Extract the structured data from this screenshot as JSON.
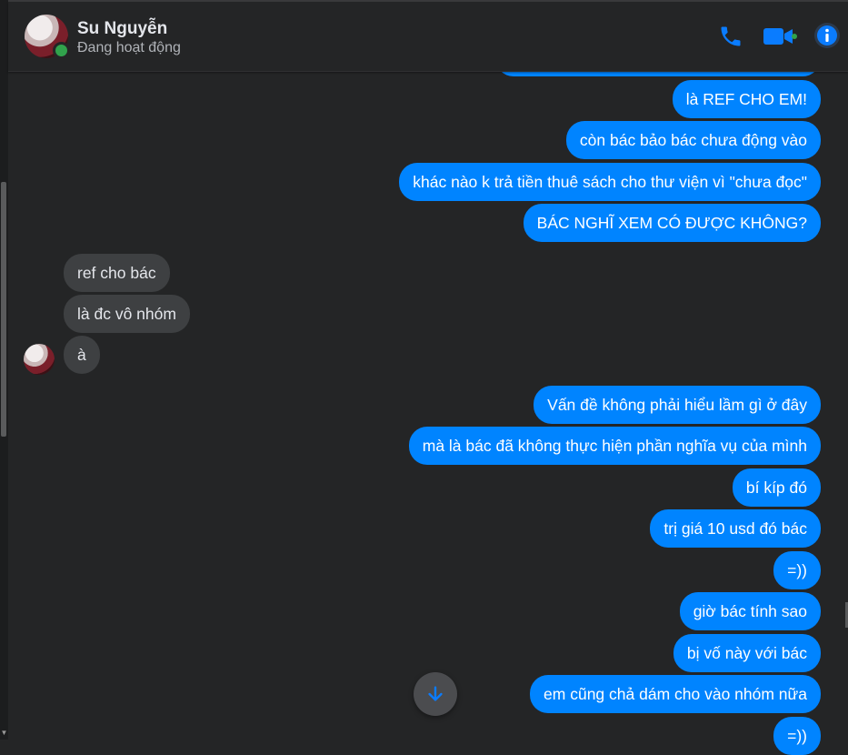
{
  "header": {
    "contact_name": "Su Nguyễn",
    "status": "Đang hoạt động"
  },
  "icons": {
    "phone": "phone-icon",
    "video": "video-camera-icon",
    "info": "info-icon",
    "scroll_down": "arrow-down-icon",
    "accent_color": "#0084ff"
  },
  "messages": [
    {
      "side": "out",
      "text": "là REF CHO EM!"
    },
    {
      "side": "out",
      "text": "còn bác bảo bác chưa động vào"
    },
    {
      "side": "out",
      "text": "khác nào k trả tiền thuê sách cho thư viện vì \"chưa đọc\""
    },
    {
      "side": "out",
      "text": "BÁC NGHĨ XEM CÓ ĐƯỢC KHÔNG?"
    },
    {
      "side": "in",
      "text": "ref cho bác"
    },
    {
      "side": "in",
      "text": "là đc vô nhóm"
    },
    {
      "side": "in",
      "text": "à"
    },
    {
      "side": "out",
      "text": "Vấn đề không phải hiểu lầm gì ở đây"
    },
    {
      "side": "out",
      "text": "mà là bác đã không thực hiện phần nghĩa vụ của mình"
    },
    {
      "side": "out",
      "text": "bí kíp đó"
    },
    {
      "side": "out",
      "text": "trị giá 10 usd đó bác"
    },
    {
      "side": "out",
      "text": "=))"
    },
    {
      "side": "out",
      "text": "giờ bác tính sao"
    },
    {
      "side": "out",
      "text": "bị vố này với bác"
    },
    {
      "side": "out",
      "text": "em cũng chả dám cho vào nhóm nữa"
    },
    {
      "side": "out",
      "text": "=))"
    }
  ]
}
